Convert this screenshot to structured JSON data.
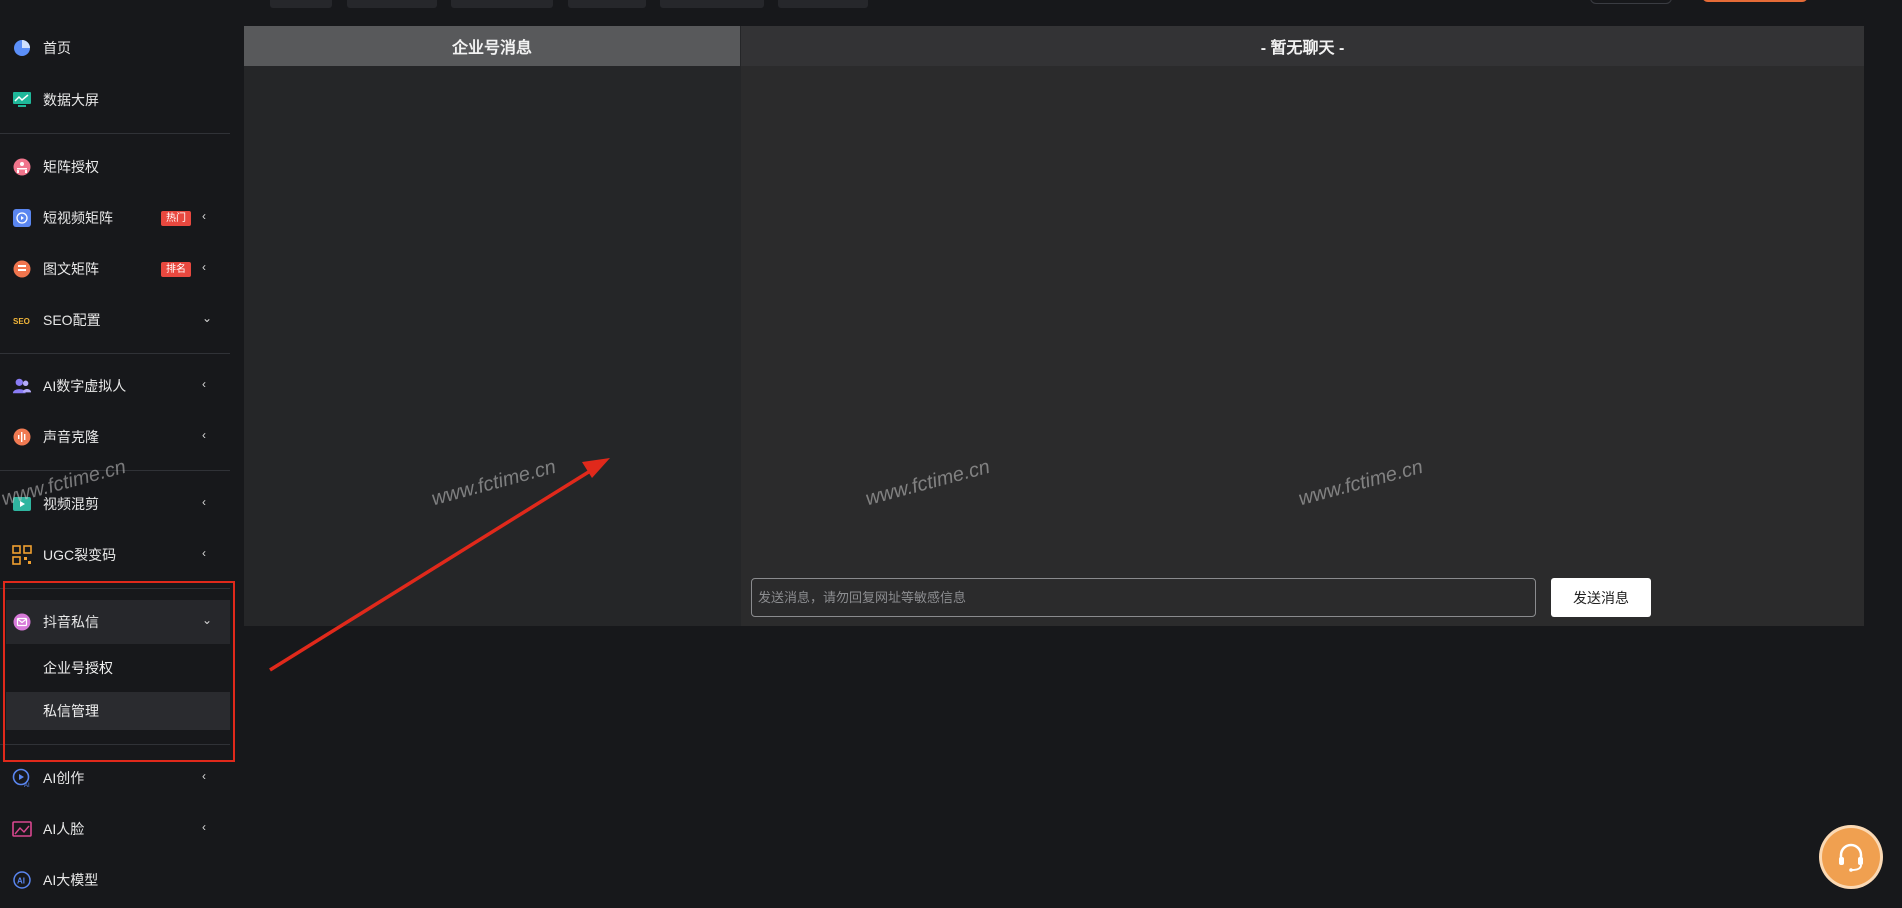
{
  "sidebar": {
    "items": [
      {
        "label": "首页",
        "icon": "pie-chart-icon"
      },
      {
        "label": "数据大屏",
        "icon": "monitor-chart-icon"
      },
      {
        "label": "矩阵授权",
        "icon": "matrix-auth-icon"
      },
      {
        "label": "短视频矩阵",
        "icon": "short-video-icon",
        "badge": "热门"
      },
      {
        "label": "图文矩阵",
        "icon": "image-text-icon",
        "badge": "排名"
      },
      {
        "label": "SEO配置",
        "icon": "seo-icon"
      },
      {
        "label": "AI数字虚拟人",
        "icon": "digital-human-icon"
      },
      {
        "label": "声音克隆",
        "icon": "voice-clone-icon"
      },
      {
        "label": "视频混剪",
        "icon": "video-mix-icon"
      },
      {
        "label": "UGC裂变码",
        "icon": "qr-code-icon"
      },
      {
        "label": "抖音私信",
        "icon": "message-icon"
      },
      {
        "label": "AI创作",
        "icon": "ai-create-icon"
      },
      {
        "label": "AI人脸",
        "icon": "ai-face-icon"
      },
      {
        "label": "AI大模型",
        "icon": "ai-model-icon"
      }
    ],
    "sub_items": [
      {
        "label": "企业号授权"
      },
      {
        "label": "私信管理"
      }
    ]
  },
  "chat": {
    "left_title": "企业号消息",
    "right_title": "- 暂无聊天 -",
    "input_placeholder": "发送消息，请勿回复网址等敏感信息",
    "send_label": "发送消息"
  },
  "watermark": "www.fctime.cn",
  "colors": {
    "accent_red": "#e8483f",
    "highlight": "#e0291b",
    "support": "#f0a050"
  }
}
